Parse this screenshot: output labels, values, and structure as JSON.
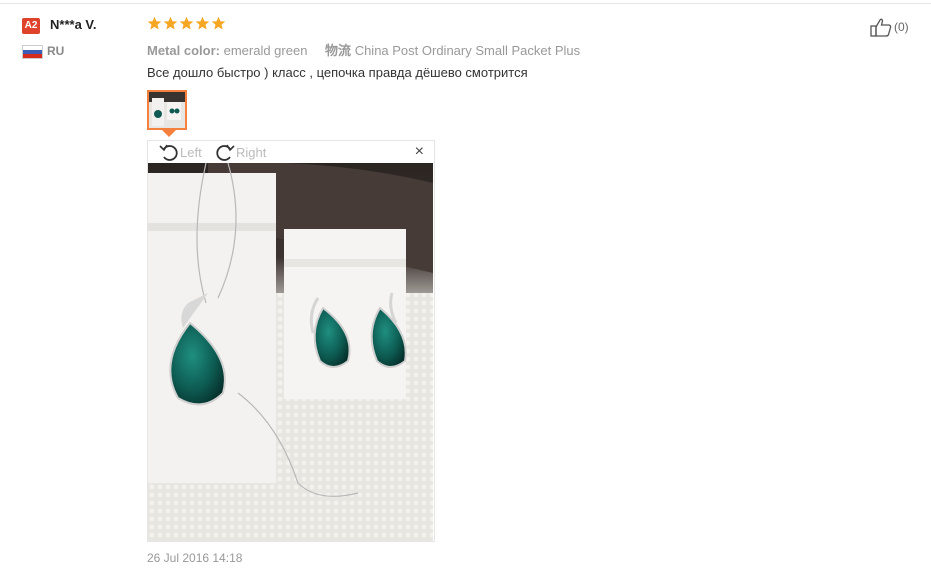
{
  "user": {
    "badge": "A2",
    "name": "N***a V.",
    "country": "RU"
  },
  "rating": {
    "stars": 5,
    "max": 5,
    "color": "#f5a623"
  },
  "attributes": {
    "color_label": "Metal color:",
    "color_value": "emerald green",
    "shipping_label": "物流",
    "shipping_value": "China Post Ordinary Small Packet Plus"
  },
  "review": {
    "text": "Все дошло быстро ) класс , цепочка правда дёшево смотрится",
    "date": "26 Jul 2016 14:18"
  },
  "viewer": {
    "rotate_left": "Left",
    "rotate_right": "Right",
    "close": "×"
  },
  "helpful": {
    "count": "(0)"
  },
  "colors": {
    "accent": "#f5803e",
    "badge": "#e0432b"
  }
}
